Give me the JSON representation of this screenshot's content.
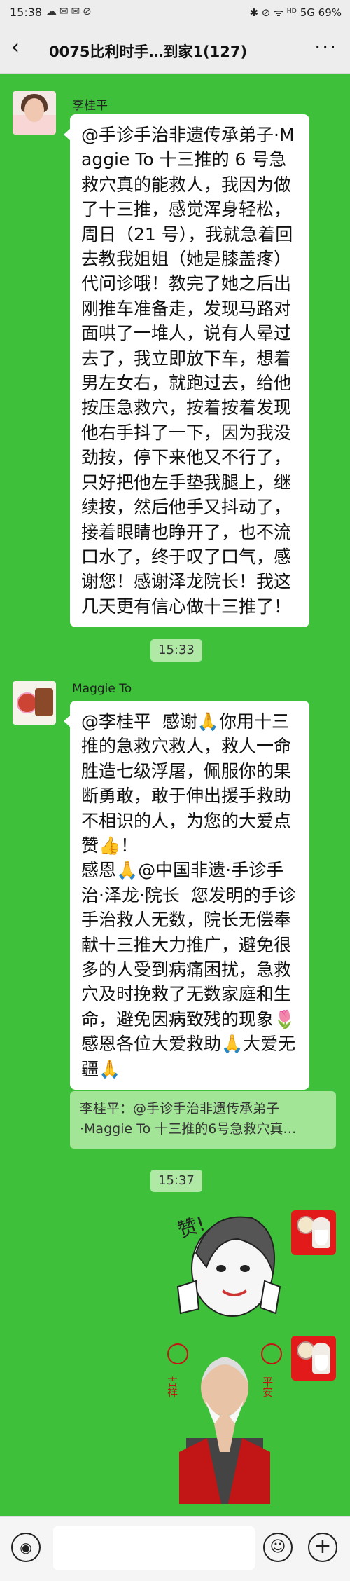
{
  "status_bar": {
    "time": "15:38",
    "app_icons": "☁✉✉⊘",
    "right": "✱ ⊘ ᯤ ᴴᴰ 5G 69%"
  },
  "header": {
    "back_icon": "‹",
    "title": "0075比利时手…到家1(127)",
    "more_icon": "···"
  },
  "messages": {
    "m1": {
      "sender": "李桂平",
      "text": "@手诊手治非遗传承弟子·Maggie To  十三推的 6 号急救穴真的能救人，我因为做了十三推，感觉浑身轻松，周日（21 号），我就急着回去教我姐姐（她是膝盖疼）代问诊哦！教完了她之后出刚推车准备走，发现马路对面哄了一堆人，说有人晕过去了，我立即放下车，想着男左女右，就跑过去，给他按压急救穴，按着按着发现他右手抖了一下，因为我没劲按，停下来他又不行了，只好把他左手垫我腿上，继续按，然后他手又抖动了，接着眼睛也睁开了，也不流口水了，终于叹了口气，感谢您！感谢泽龙院长！我这几天更有信心做十三推了！"
    },
    "time1": "15:33",
    "m2": {
      "sender": "Maggie To",
      "text": "@李桂平  感谢🙏你用十三推的急救穴救人，救人一命胜造七级浮屠，佩服你的果断勇敢，敢于伸出援手救助不相识的人，为您的大爱点赞👍！\n感恩🙏@中国非遗·手诊手治·泽龙·院长  您发明的手诊手治救人无数，院长无偿奉献十三推大力推广，避免很多的人受到病痛困扰，急救穴及时挽救了无数家庭和生命，避免因病致残的现象🌷感恩各位大爱救助🙏大爱无疆🙏",
      "quote": "李桂平：@手诊手治非遗传承弟子·Maggie To 十三推的6号急救穴真…"
    },
    "time2": "15:37",
    "sticker1_text": "赞!",
    "sticker2_left": "吉祥",
    "sticker2_right": "平安"
  },
  "input_bar": {
    "voice_icon": "◉",
    "emoji_icon": "☺",
    "plus_icon": "+"
  },
  "colors": {
    "chat_background": "#3ec03a",
    "time_chip": "#b0e8a6",
    "quote_background": "#a3e597",
    "header_background": "#ededed"
  }
}
